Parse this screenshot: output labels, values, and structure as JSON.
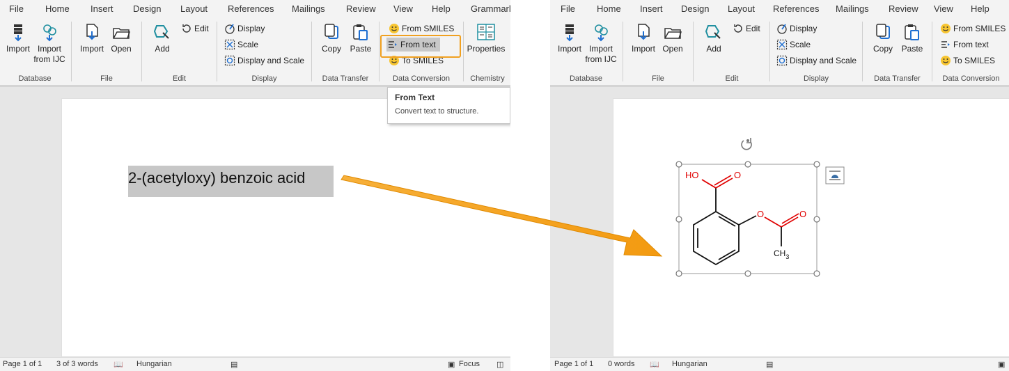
{
  "left": {
    "menu": [
      "File",
      "Home",
      "Insert",
      "Design",
      "Layout",
      "References",
      "Mailings",
      "Review",
      "View",
      "Help",
      "Grammarly"
    ],
    "groups": {
      "database": {
        "label": "Database",
        "import": "Import",
        "import_ijc_1": "Import",
        "import_ijc_2": "from IJC"
      },
      "file": {
        "label": "File",
        "import": "Import",
        "open": "Open"
      },
      "edit": {
        "label": "Edit",
        "add": "Add",
        "edit": "Edit"
      },
      "display": {
        "label": "Display",
        "display": "Display",
        "scale": "Scale",
        "display_scale": "Display and Scale"
      },
      "transfer": {
        "label": "Data Transfer",
        "copy": "Copy",
        "paste": "Paste"
      },
      "conversion": {
        "label": "Data Conversion",
        "from_smiles": "From SMILES",
        "from_text": "From text",
        "to_smiles": "To SMILES"
      },
      "chemistry": {
        "label": "Chemistry",
        "properties": "Properties"
      }
    },
    "tooltip": {
      "title": "From Text",
      "body": "Convert text to structure."
    },
    "document_text": "2-(acetyloxy) benzoic acid",
    "status": {
      "page": "Page 1 of 1",
      "words": "3 of 3 words",
      "language": "Hungarian",
      "focus": "Focus"
    }
  },
  "right": {
    "menu": [
      "File",
      "Home",
      "Insert",
      "Design",
      "Layout",
      "References",
      "Mailings",
      "Review",
      "View",
      "Help"
    ],
    "groups": {
      "database": {
        "label": "Database",
        "import": "Import",
        "import_ijc_1": "Import",
        "import_ijc_2": "from IJC"
      },
      "file": {
        "label": "File",
        "import": "Import",
        "open": "Open"
      },
      "edit": {
        "label": "Edit",
        "add": "Add",
        "edit": "Edit"
      },
      "display": {
        "label": "Display",
        "display": "Display",
        "scale": "Scale",
        "display_scale": "Display and Scale"
      },
      "transfer": {
        "label": "Data Transfer",
        "copy": "Copy",
        "paste": "Paste"
      },
      "conversion": {
        "label": "Data Conversion",
        "from_smiles": "From SMILES",
        "from_text": "From text",
        "to_smiles": "To SMILES"
      }
    },
    "molecule": {
      "ho": "HO",
      "o1": "O",
      "o2": "O",
      "o3": "O",
      "ch3": "CH",
      "ch3_sub": "3"
    },
    "status": {
      "page": "Page 1 of 1",
      "words": "0 words",
      "language": "Hungarian"
    }
  },
  "colors": {
    "accent_orange": "#f0a020",
    "arrow_orange": "#f5a01a",
    "oxygen_red": "#e00000",
    "ribbon_bg": "#f3f3f3",
    "canvas_bg": "#e6e6e6"
  },
  "icons": [
    "import-icon",
    "import-ijc-icon",
    "file-import-icon",
    "open-folder-icon",
    "add-structure-icon",
    "edit-icon",
    "display-icon",
    "scale-icon",
    "display-scale-icon",
    "copy-icon",
    "paste-icon",
    "smiles-face-icon",
    "text-lines-icon",
    "properties-icon",
    "rotate-handle-icon",
    "layout-options-icon",
    "focus-icon",
    "read-mode-icon",
    "proofing-icon",
    "macro-icon"
  ]
}
